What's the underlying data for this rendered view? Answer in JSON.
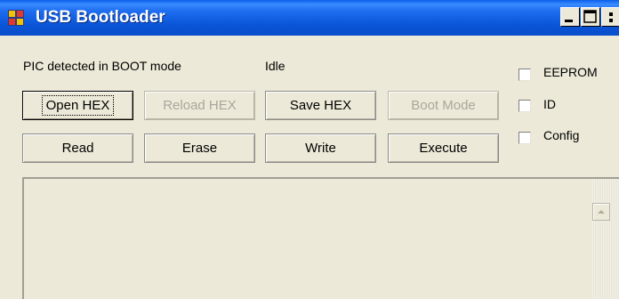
{
  "window": {
    "title": "USB Bootloader"
  },
  "status": {
    "detection": "PIC detected in BOOT mode",
    "state": "Idle"
  },
  "buttons": {
    "open_hex": "Open HEX",
    "reload_hex": "Reload HEX",
    "save_hex": "Save HEX",
    "boot_mode": "Boot Mode",
    "read": "Read",
    "erase": "Erase",
    "write": "Write",
    "execute": "Execute"
  },
  "options": {
    "eeprom": {
      "label": "EEPROM",
      "checked": false
    },
    "id": {
      "label": "ID",
      "checked": false
    },
    "config": {
      "label": "Config",
      "checked": false
    }
  },
  "log": {
    "text": ""
  },
  "colors": {
    "titlebar": "#0a55d8",
    "window_bg": "#ece9d8",
    "disabled_text": "#a9a79c"
  },
  "icons": {
    "app": "app-window-icon",
    "minimize": "minimize-icon",
    "maximize": "maximize-icon",
    "scroll_up": "scroll-up-arrow-icon"
  }
}
